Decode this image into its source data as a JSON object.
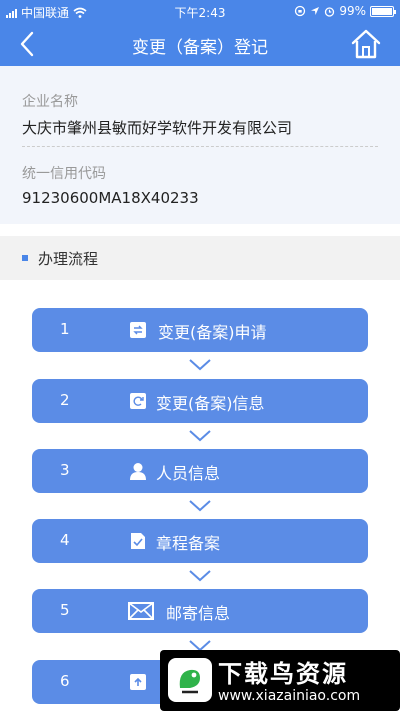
{
  "status_bar": {
    "carrier": "中国联通",
    "time": "下午2:43",
    "battery_text": "99%",
    "battery_level": 0.99
  },
  "nav": {
    "title": "变更（备案）登记"
  },
  "company": {
    "name_label": "企业名称",
    "name_value": "大庆市肇州县敏而好学软件开发有限公司",
    "credit_label": "统一信用代码",
    "credit_value": "91230600MA18X40233"
  },
  "process": {
    "header": "办理流程",
    "steps": [
      {
        "num": "1",
        "label": "变更(备案)申请",
        "icon": "edit-doc-icon"
      },
      {
        "num": "2",
        "label": "变更(备案)信息",
        "icon": "refresh-doc-icon"
      },
      {
        "num": "3",
        "label": "人员信息",
        "icon": "person-icon"
      },
      {
        "num": "4",
        "label": "章程备案",
        "icon": "doc-check-icon"
      },
      {
        "num": "5",
        "label": "邮寄信息",
        "icon": "mail-icon"
      },
      {
        "num": "6",
        "label": "",
        "icon": "upload-icon"
      }
    ]
  },
  "watermark": {
    "title": "下载鸟资源",
    "url": "www.xiazainiao.com"
  },
  "colors": {
    "primary": "#4a86e8",
    "step_bg": "#5b8ce6"
  }
}
